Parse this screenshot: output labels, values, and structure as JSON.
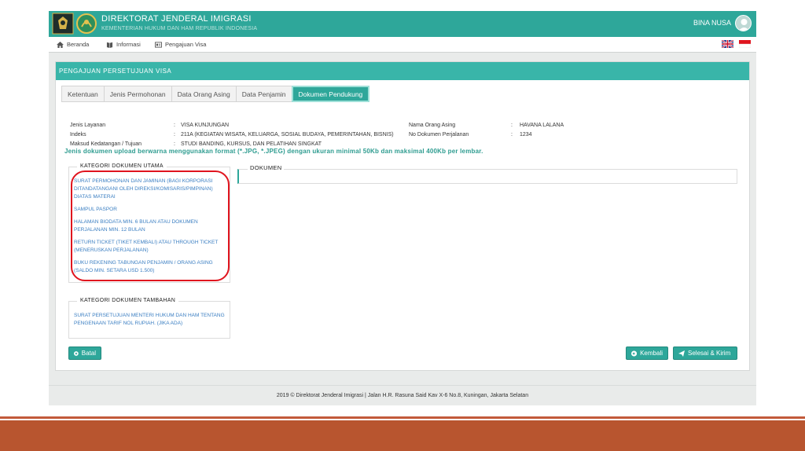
{
  "header": {
    "title": "DIREKTORAT JENDERAL IMIGRASI",
    "subtitle": "KEMENTERIAN HUKUM DAN HAM REPUBLIK INDONESIA",
    "user_name": "BINA NUSA"
  },
  "nav": {
    "items": [
      {
        "label": "Beranda",
        "icon": "home-icon"
      },
      {
        "label": "Informasi",
        "icon": "book-icon"
      },
      {
        "label": "Pengajuan Visa",
        "icon": "id-card-icon"
      }
    ],
    "languages": [
      "english-flag",
      "indonesia-flag"
    ]
  },
  "panel": {
    "title": "PENGAJUAN PERSETUJUAN VISA",
    "tabs": [
      {
        "label": "Ketentuan",
        "active": false
      },
      {
        "label": "Jenis Permohonan",
        "active": false
      },
      {
        "label": "Data Orang Asing",
        "active": false
      },
      {
        "label": "Data Penjamin",
        "active": false
      },
      {
        "label": "Dokumen Pendukung",
        "active": true
      }
    ],
    "info_left": [
      {
        "label": "Jenis Layanan",
        "value": "VISA KUNJUNGAN"
      },
      {
        "label": "Indeks",
        "value": "211A  (KEGIATAN WISATA, KELUARGA, SOSIAL BUDAYA, PEMERINTAHAN, BISNIS)"
      },
      {
        "label": "Maksud Kedatangan / Tujuan",
        "value": "STUDI BANDING, KURSUS, DAN PELATIHAN SINGKAT"
      }
    ],
    "info_right": [
      {
        "label": "Nama Orang Asing",
        "value": "HAVANA LALANA"
      },
      {
        "label": "No Dokumen Perjalanan",
        "value": "1234"
      }
    ],
    "colon": ":",
    "upload_note": "Jenis dokumen upload berwarna menggunakan format (*.JPG, *.JPEG) dengan ukuran minimal 50Kb dan maksimal 400Kb per lembar.",
    "main_category": {
      "title": "KATEGORI DOKUMEN UTAMA",
      "items": [
        "SURAT PERMOHONAN DAN JAMINAN (BAGI KORPORASI DITANDATANGANI OLEH DIREKSI/KOMISARIS/PIMPINAN) DIATAS MATERAI",
        "SAMPUL PASPOR",
        "HALAMAN BIODATA MIN. 6 BULAN ATAU DOKUMEN PERJALANAN MIN. 12 BULAN",
        "RETURN TICKET (TIKET KEMBALI) ATAU THROUGH TICKET (MENERUSKAN PERJALANAN)",
        "BUKU REKENING TABUNGAN PENJAMIN / ORANG ASING (SALDO MIN. SETARA USD 1.500)"
      ]
    },
    "extra_category": {
      "title": "KATEGORI DOKUMEN TAMBAHAN",
      "items": [
        "SURAT PERSETUJUAN MENTERI HUKUM DAN HAM TENTANG PENGENAAN TARIF NOL RUPIAH. (JIKA ADA)"
      ]
    },
    "documents_title": "DOKUMEN",
    "buttons": {
      "cancel": "Batal",
      "back": "Kembali",
      "submit": "Selesai & Kirim"
    }
  },
  "footer": {
    "text": "2019 © Direktorat Jenderal Imigrasi | Jalan H.R. Rasuna Said Kav X-6 No.8, Kuningan, Jakarta Selatan"
  },
  "colors": {
    "brand": "#2ea79a",
    "panel_header": "#39b5a9",
    "link": "#3a7ec2",
    "highlight": "#e0141e",
    "slide_band": "#b8552f"
  }
}
